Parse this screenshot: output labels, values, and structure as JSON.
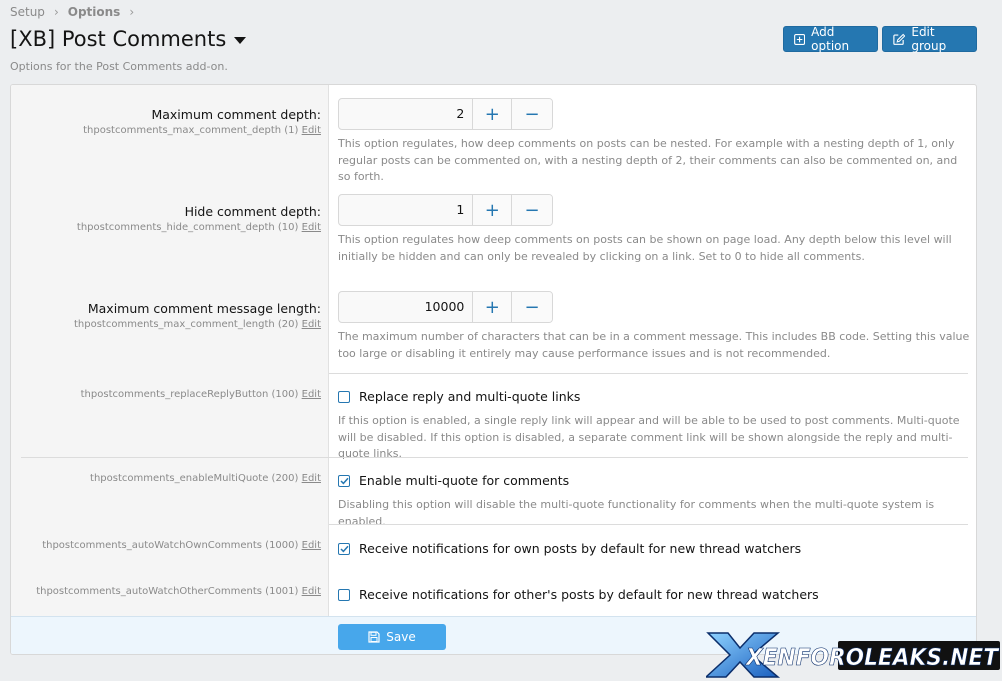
{
  "breadcrumb": [
    "Setup",
    "Options"
  ],
  "page": {
    "title": "[XB] Post Comments",
    "description": "Options for the Post Comments add-on."
  },
  "actions": {
    "add_option": "Add option",
    "edit_group": "Edit group"
  },
  "edit_link": "Edit",
  "options": {
    "max_depth": {
      "label": "Maximum comment depth:",
      "key": "thpostcomments_max_comment_depth (1)",
      "value": "2",
      "explain": "This option regulates, how deep comments on posts can be nested. For example with a nesting depth of 1, only regular posts can be commented on, with a nesting depth of 2, their comments can also be commented on, and so forth."
    },
    "hide_depth": {
      "label": "Hide comment depth:",
      "key": "thpostcomments_hide_comment_depth (10)",
      "value": "1",
      "explain": "This option regulates how deep comments on posts can be shown on page load. Any depth below this level will initially be hidden and can only be revealed by clicking on a link. Set to 0 to hide all comments."
    },
    "max_length": {
      "label": "Maximum comment message length:",
      "key": "thpostcomments_max_comment_length (20)",
      "value": "10000",
      "explain": "The maximum number of characters that can be in a comment message. This includes BB code. Setting this value too large or disabling it entirely may cause performance issues and is not recommended."
    },
    "replace_reply": {
      "key": "thpostcomments_replaceReplyButton (100)",
      "check_label": "Replace reply and multi-quote links",
      "checked": false,
      "explain": "If this option is enabled, a single reply link will appear and will be able to be used to post comments. Multi-quote will be disabled. If this option is disabled, a separate comment link will be shown alongside the reply and multi-quote links."
    },
    "multi_quote": {
      "key": "thpostcomments_enableMultiQuote (200)",
      "check_label": "Enable multi-quote for comments",
      "checked": true,
      "explain": "Disabling this option will disable the multi-quote functionality for comments when the multi-quote system is enabled."
    },
    "watch_own": {
      "key": "thpostcomments_autoWatchOwnComments (1000)",
      "check_label": "Receive notifications for own posts by default for new thread watchers",
      "checked": true
    },
    "watch_other": {
      "key": "thpostcomments_autoWatchOtherComments (1001)",
      "check_label": "Receive notifications for other's posts by default for new thread watchers",
      "checked": false
    }
  },
  "save_label": "Save",
  "watermark": "XENFOROLEAKS.NET",
  "colors": {
    "primary": "#2577b1",
    "save": "#47a7eb",
    "footer_bg": "#edf6fd"
  }
}
